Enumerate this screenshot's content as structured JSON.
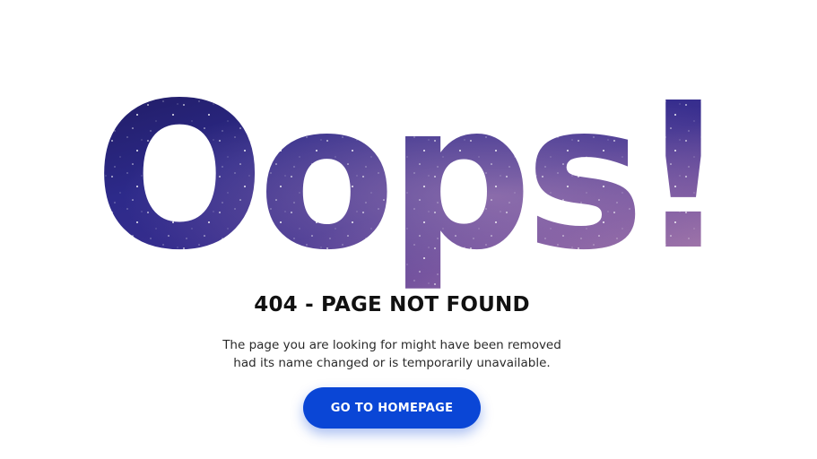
{
  "hero": {
    "text": "Oops!",
    "fill_colors": [
      "#1a1552",
      "#2d2a8a",
      "#3a2f8f",
      "#6a4a9a",
      "#a87aa8"
    ]
  },
  "error": {
    "title": "404 - PAGE NOT FOUND",
    "description_line1": "The page you are looking for might have been removed",
    "description_line2": "had its name changed or is temporarily unavailable."
  },
  "cta": {
    "label": "GO TO HOMEPAGE",
    "color": "#0a46d6"
  }
}
